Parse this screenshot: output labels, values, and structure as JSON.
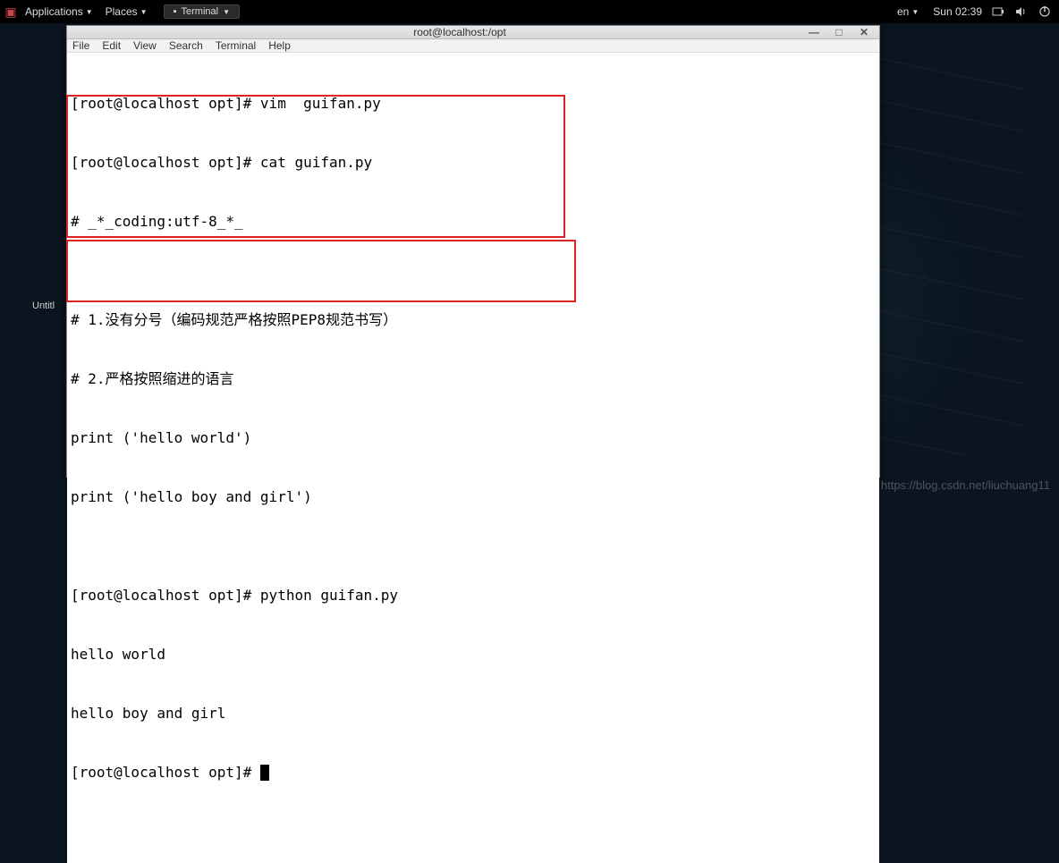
{
  "panel": {
    "applications": "Applications",
    "places": "Places",
    "taskbar_app": "Terminal",
    "lang": "en",
    "clock": "Sun 02:39"
  },
  "window": {
    "title": "root@localhost:/opt",
    "menus": [
      "File",
      "Edit",
      "View",
      "Search",
      "Terminal",
      "Help"
    ]
  },
  "terminal": {
    "lines": [
      "[root@localhost opt]# vim  guifan.py",
      "[root@localhost opt]# cat guifan.py",
      "# _*_coding:utf-8_*_",
      "",
      "# 1.没有分号（编码规范严格按照PEP8规范书写）",
      "# 2.严格按照缩进的语言",
      "print ('hello world')",
      "print ('hello boy and girl')",
      "",
      "[root@localhost opt]# python guifan.py",
      "hello world",
      "hello boy and girl",
      "[root@localhost opt]# "
    ]
  },
  "dock": {
    "untitled": "Untitl"
  },
  "watermark": "https://blog.csdn.net/liuchuang11"
}
